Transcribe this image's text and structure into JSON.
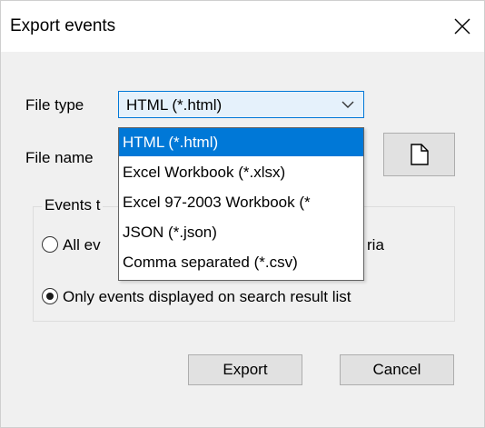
{
  "dialog": {
    "title": "Export events",
    "file_type_label": "File type",
    "file_type_value": "HTML (*.html)",
    "file_name_label": "File name",
    "file_name_value": "",
    "events_group_label": "Events t",
    "radio_all_label_left": "All ev",
    "radio_all_label_right": "ria",
    "radio_displayed_label": "Only events displayed on search result list",
    "radio_selected": "displayed",
    "export_button": "Export",
    "cancel_button": "Cancel"
  },
  "dropdown": {
    "selected_index": 0,
    "options": [
      "HTML (*.html)",
      "Excel Workbook (*.xlsx)",
      "Excel 97-2003 Workbook (*",
      "JSON (*.json)",
      "Comma separated (*.csv)"
    ]
  },
  "colors": {
    "accent": "#0078d7",
    "window_bg": "#f0f0f0",
    "titlebar_bg": "#ffffff"
  },
  "icons": {
    "close": "close-icon",
    "chevron": "chevron-down-icon",
    "browse": "document-icon"
  }
}
